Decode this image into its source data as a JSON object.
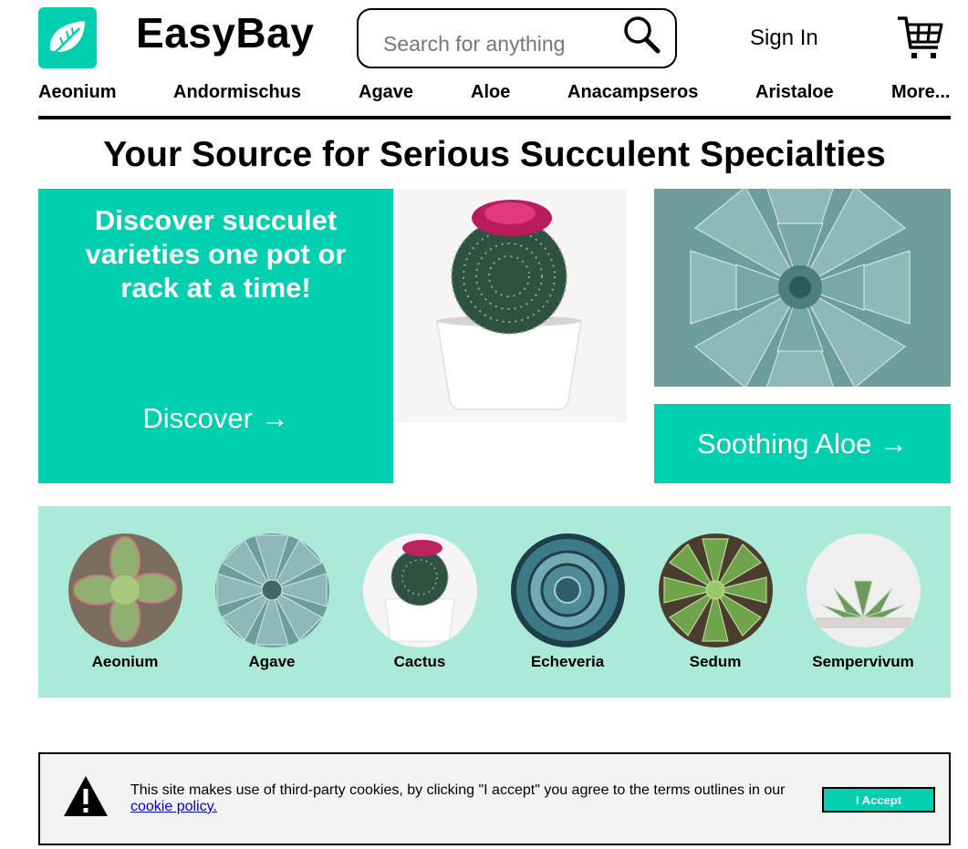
{
  "header": {
    "brand": "EasyBay",
    "search_placeholder": "Search for anything",
    "sign_in": "Sign In",
    "icons": {
      "logo": "leaf-icon",
      "search": "magnifier-icon",
      "cart": "shopping-cart-icon"
    }
  },
  "nav": {
    "items": [
      "Aeonium",
      "Andormischus",
      "Agave",
      "Aloe",
      "Anacampseros",
      "Aristaloe",
      "More..."
    ]
  },
  "headline": "Your Source for Serious Succulent Specialties",
  "hero": {
    "promo_title": "Discover succulet varieties one pot or rack at a time!",
    "promo_link": "Discover →",
    "aloe_link": "Soothing Aloe  →"
  },
  "categories": [
    {
      "label": "Aeonium"
    },
    {
      "label": "Agave"
    },
    {
      "label": "Cactus"
    },
    {
      "label": "Echeveria"
    },
    {
      "label": "Sedum"
    },
    {
      "label": "Sempervivum"
    }
  ],
  "cookie": {
    "text": "This site makes use of third-party cookies, by clicking \"I accept\" you agree to the terms outlines in our",
    "link": "cookie policy.",
    "accept": "I Accept",
    "icon": "warning-icon"
  },
  "colors": {
    "accent": "#00cfb0",
    "category_panel": "#abe9d8",
    "cookie_bg": "#f3f3f3"
  }
}
